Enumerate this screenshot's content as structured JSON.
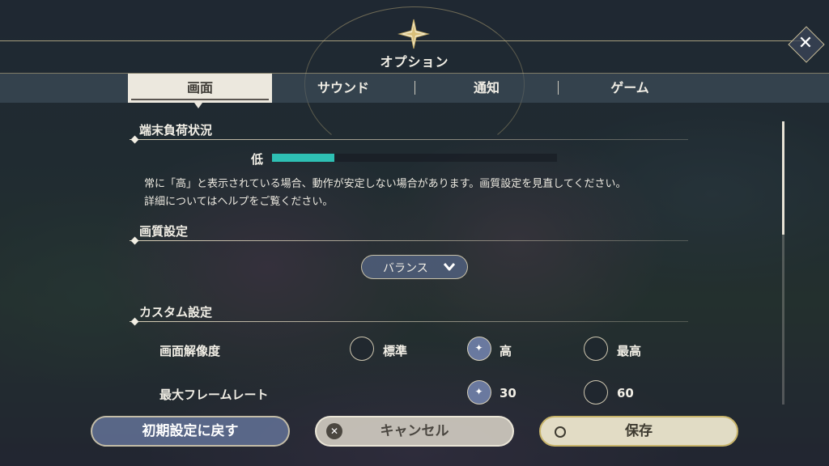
{
  "header": {
    "title": "オプション",
    "close_label": "✕"
  },
  "tabs": [
    {
      "label": "画面",
      "active": true
    },
    {
      "label": "サウンド",
      "active": false
    },
    {
      "label": "通知",
      "active": false
    },
    {
      "label": "ゲーム",
      "active": false
    }
  ],
  "load_status": {
    "title": "端末負荷状況",
    "level_label": "低",
    "level_fraction": 0.22,
    "note_line1": "常に「高」と表示されている場合、動作が安定しない場合があります。画質設定を見直してください。",
    "note_line2": "詳細についてはヘルプをご覧ください。"
  },
  "quality": {
    "title": "画質設定",
    "selected": "バランス"
  },
  "custom": {
    "title": "カスタム設定",
    "resolution": {
      "label": "画面解像度",
      "options": [
        "標準",
        "高",
        "最高"
      ],
      "selected": "高"
    },
    "framerate": {
      "label": "最大フレームレート",
      "options": [
        "30",
        "60"
      ],
      "selected": "30"
    }
  },
  "buttons": {
    "reset": "初期設定に戻す",
    "cancel": "キャンセル",
    "save": "保存"
  },
  "colors": {
    "accent_teal": "#2ec0b4",
    "gold": "#c8b46a"
  }
}
